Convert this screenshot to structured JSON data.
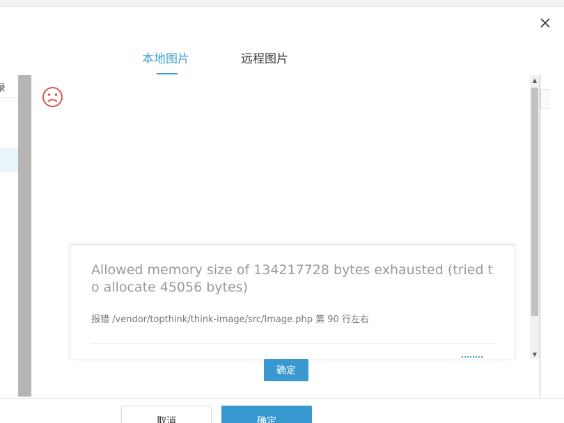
{
  "dialog": {
    "close_label": "×",
    "tabs": [
      {
        "label": "本地图片",
        "active": true
      },
      {
        "label": "远程图片",
        "active": false
      }
    ]
  },
  "background_list": {
    "partial_text": "录"
  },
  "error_page": {
    "icon": "sad-face-icon",
    "message": "Allowed memory size of 134217728 bytes exhausted (tried to allocate 45056 bytes)",
    "detail": "报错 /vendor/topthink/think-image/src/Image.php 第 90 行左右",
    "confirm_label": "确定"
  },
  "footer": {
    "cancel_label": "取消",
    "confirm_label": "确定"
  },
  "colors": {
    "accent": "#3b9fd1",
    "button_primary": "#3a98d0",
    "error_icon": "#d9534f"
  }
}
